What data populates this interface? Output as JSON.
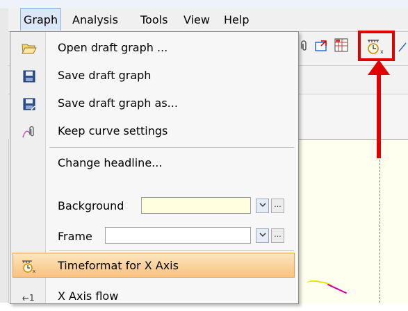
{
  "menubar": {
    "items": [
      "Graph",
      "Analysis",
      "Tools",
      "View",
      "Help"
    ],
    "active": "Graph"
  },
  "dropdown": {
    "items": [
      {
        "label": "Open draft graph ...",
        "icon": "open-folder-icon"
      },
      {
        "label": "Save draft graph",
        "icon": "floppy-disk-icon"
      },
      {
        "label": "Save draft graph as...",
        "icon": "floppy-disk-save-as-icon"
      },
      {
        "label": "Keep curve settings",
        "icon": "curve-pin-icon"
      },
      {
        "label": "Change headline...",
        "icon": ""
      },
      {
        "label": "Background",
        "icon": ""
      },
      {
        "label": "Frame",
        "icon": ""
      },
      {
        "label": "Timeformat for X Axis",
        "icon": "timeformat-clock-icon",
        "selected": true
      },
      {
        "label": "X Axis flow",
        "icon": "x-axis-flow-icon"
      }
    ],
    "background_field": {
      "value": "",
      "color": "#ffffe0"
    },
    "frame_field": {
      "value": "",
      "color": "#ffffff"
    },
    "dots_label": "..."
  },
  "annotation": {
    "color": "#e00000"
  }
}
